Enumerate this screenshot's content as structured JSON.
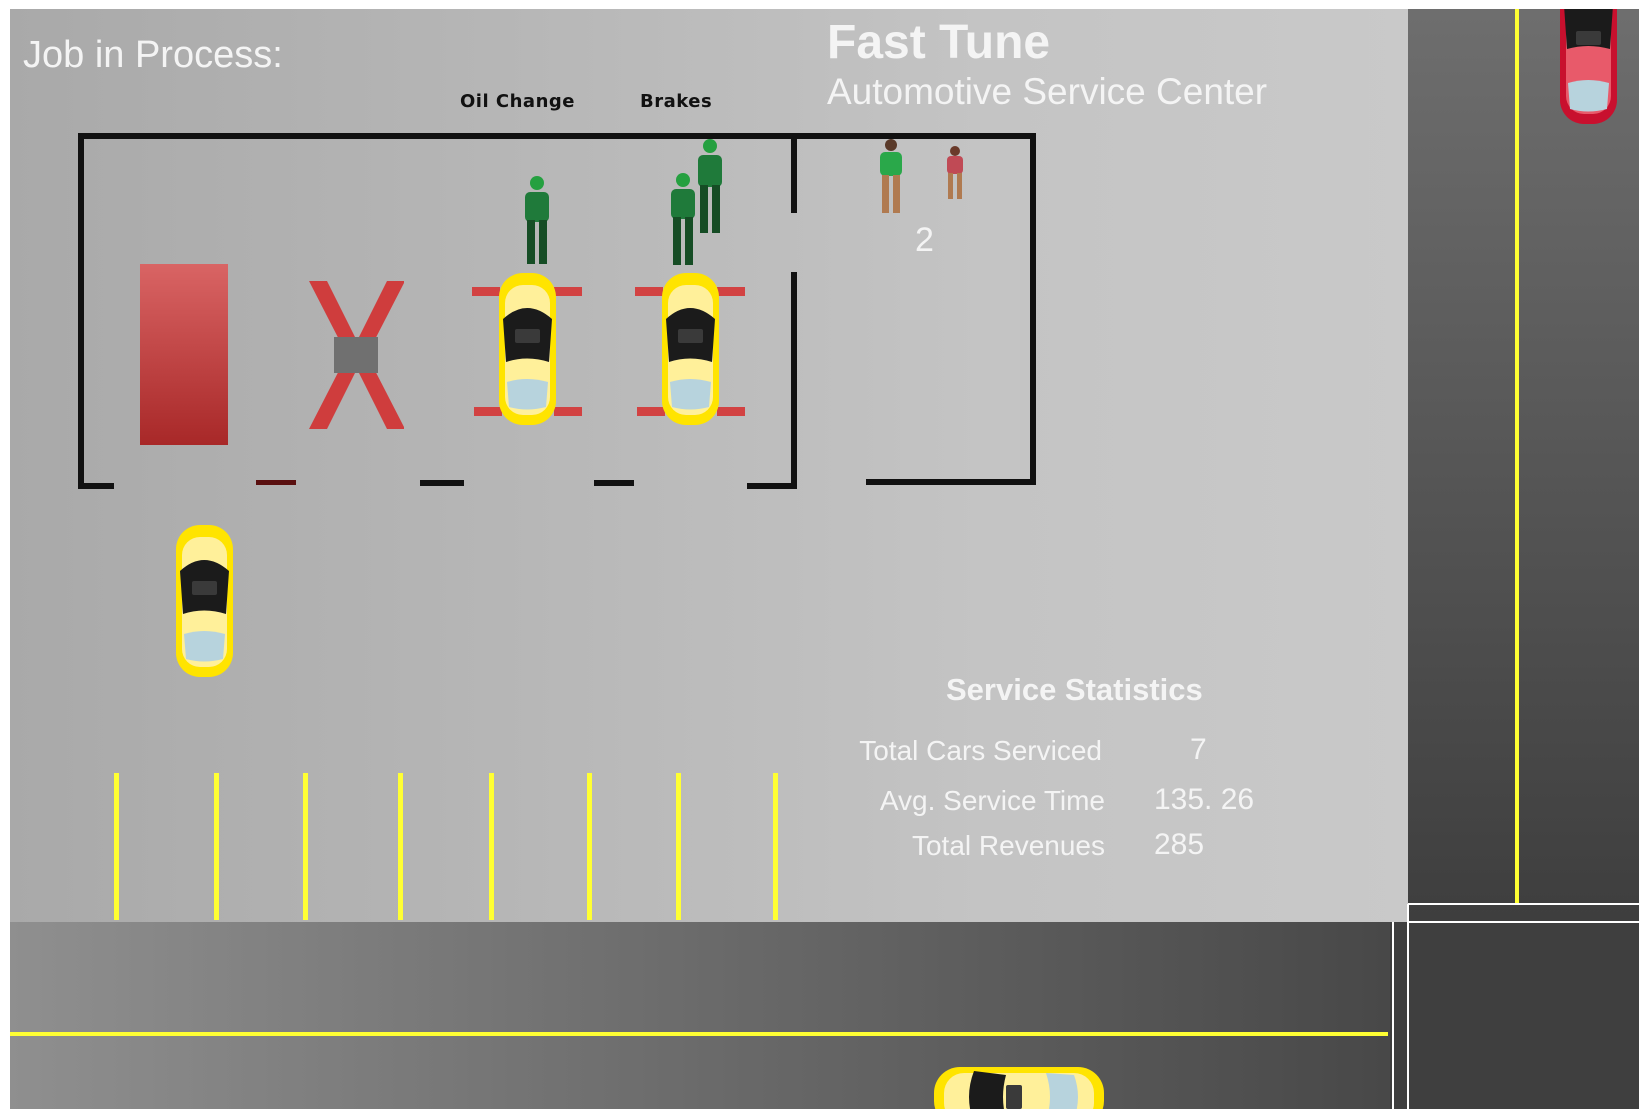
{
  "header": {
    "job_label": "Job in Process:",
    "brand_title": "Fast Tune",
    "brand_subtitle": "Automotive Service Center"
  },
  "bays": [
    {
      "label": "Oil Change"
    },
    {
      "label": "Brakes"
    }
  ],
  "waiting_area": {
    "queue_count": "2"
  },
  "statistics": {
    "title": "Service Statistics",
    "rows": [
      {
        "label": "Total Cars Serviced",
        "value": "7"
      },
      {
        "label": "Avg. Service Time",
        "value": "135. 26"
      },
      {
        "label": "Total Revenues",
        "value": "285"
      }
    ]
  },
  "colors": {
    "lot": "#bdbdbd",
    "road": "#4a4a4a",
    "lane_line": "#ffff33",
    "car_yellow": "#ffe400",
    "car_red": "#c8102e",
    "lift_red": "#d23c3c",
    "worker_green": "#1f7a3a"
  },
  "icons": [
    "car-icon",
    "service-lift-icon",
    "worker-icon",
    "customer-icon",
    "workbench-icon"
  ]
}
